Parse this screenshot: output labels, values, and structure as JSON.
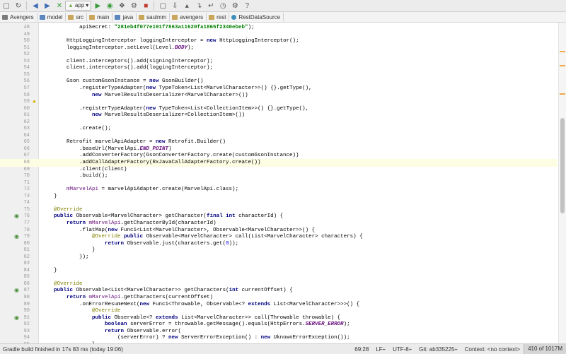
{
  "toolbar": {
    "run_config": "app"
  },
  "breadcrumb": [
    "Avengers",
    "model",
    "src",
    "main",
    "java",
    "saulmm",
    "avengers",
    "rest",
    "RestDataSource"
  ],
  "code": [
    {
      "n": "48",
      "t": "            apiSecret: \"281eb4f077e191f7863a11620fa1865f2340ebeb\");"
    },
    {
      "n": "49",
      "t": ""
    },
    {
      "n": "50",
      "t": "        HttpLoggingInterceptor loggingInterceptor = new HttpLoggingInterceptor();"
    },
    {
      "n": "51",
      "t": "        loggingInterceptor.setLevel(Level.BODY);"
    },
    {
      "n": "52",
      "t": ""
    },
    {
      "n": "53",
      "t": "        client.interceptors().add(signingInterceptor);"
    },
    {
      "n": "54",
      "t": "        client.interceptors().add(loggingInterceptor);"
    },
    {
      "n": "55",
      "t": ""
    },
    {
      "n": "56",
      "t": "        Gson customGsonInstance = new GsonBuilder()"
    },
    {
      "n": "57",
      "t": "            .registerTypeAdapter(new TypeToken<List<MarvelCharacter>>() {}.getType(),"
    },
    {
      "n": "58",
      "t": "                new MarvelResultsDeserializer<MarvelCharacter>())"
    },
    {
      "n": "59",
      "t": ""
    },
    {
      "n": "60",
      "t": "            .registerTypeAdapter(new TypeToken<List<CollectionItem>>() {}.getType(),"
    },
    {
      "n": "61",
      "t": "                new MarvelResultsDeserializer<CollectionItem>())"
    },
    {
      "n": "62",
      "t": ""
    },
    {
      "n": "63",
      "t": "            .create();"
    },
    {
      "n": "64",
      "t": ""
    },
    {
      "n": "65",
      "t": "        Retrofit marvelApiAdapter = new Retrofit.Builder()"
    },
    {
      "n": "66",
      "t": "            .baseUrl(MarvelApi.END_POINT)"
    },
    {
      "n": "67",
      "t": "            .addConverterFactory(GsonConverterFactory.create(customGsonInstance))"
    },
    {
      "n": "68",
      "t": "            .addCallAdapterFactory(RxJavaCallAdapterFactory.create())"
    },
    {
      "n": "69",
      "t": "            .client(client)"
    },
    {
      "n": "70",
      "t": "            .build();"
    },
    {
      "n": "71",
      "t": ""
    },
    {
      "n": "72",
      "t": "        mMarvelApi = marvelApiAdapter.create(MarvelApi.class);"
    },
    {
      "n": "73",
      "t": "    }"
    },
    {
      "n": "74",
      "t": ""
    },
    {
      "n": "75",
      "t": "    @Override"
    },
    {
      "n": "76",
      "t": "    public Observable<MarvelCharacter> getCharacter(final int characterId) {"
    },
    {
      "n": "77",
      "t": "        return mMarvelApi.getCharacterById(characterId)"
    },
    {
      "n": "78",
      "t": "            .flatMap(new Func1<List<MarvelCharacter>, Observable<MarvelCharacter>>() {"
    },
    {
      "n": "79",
      "t": "                @Override public Observable<MarvelCharacter> call(List<MarvelCharacter> characters) {"
    },
    {
      "n": "80",
      "t": "                    return Observable.just(characters.get(0));"
    },
    {
      "n": "81",
      "t": "                }"
    },
    {
      "n": "82",
      "t": "            });"
    },
    {
      "n": "83",
      "t": ""
    },
    {
      "n": "84",
      "t": "    }"
    },
    {
      "n": "85",
      "t": ""
    },
    {
      "n": "86",
      "t": "    @Override"
    },
    {
      "n": "87",
      "t": "    public Observable<List<MarvelCharacter>> getCharacters(int currentOffset) {"
    },
    {
      "n": "88",
      "t": "        return mMarvelApi.getCharacters(currentOffset)"
    },
    {
      "n": "89",
      "t": "            .onErrorResumeNext(new Func1<Throwable, Observable<? extends List<MarvelCharacter>>>() {"
    },
    {
      "n": "90",
      "t": "                @Override"
    },
    {
      "n": "91",
      "t": "                public Observable<? extends List<MarvelCharacter>> call(Throwable throwable) {"
    },
    {
      "n": "92",
      "t": "                    boolean serverError = throwable.getMessage().equals(HttpErrors.SERVER_ERROR);"
    },
    {
      "n": "93",
      "t": "                    return Observable.error("
    },
    {
      "n": "94",
      "t": "                        (serverError) ? new ServerErrorException() : new UknownErrorException());"
    },
    {
      "n": "95",
      "t": "                }"
    },
    {
      "n": "96",
      "t": "            });"
    }
  ],
  "status": {
    "message": "Gradle build finished in 17s 83 ms (today 19:06)",
    "position": "69:28",
    "line_sep": "LF÷",
    "encoding": "UTF-8÷",
    "vcs": "Git: ab335225÷",
    "context": "Context: <no context>",
    "memory": "410 of 1017M"
  }
}
